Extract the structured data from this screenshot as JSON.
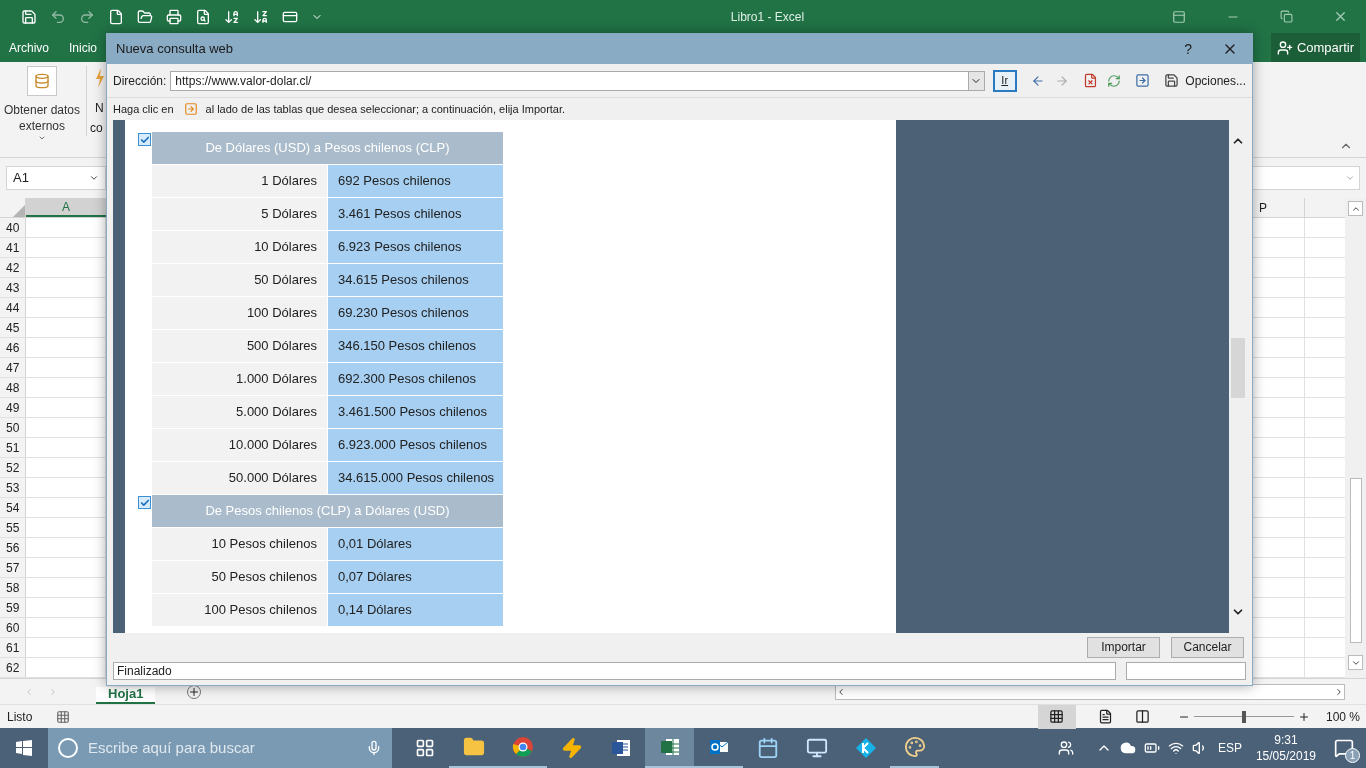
{
  "excel": {
    "title": "Libro1 - Excel",
    "ribbon_tabs": [
      "Archivo",
      "Inicio"
    ],
    "share": "Compartir",
    "ribbon": {
      "get_external_data": "Obtener datos externos",
      "cut_label_1": "N",
      "cut_label_2": "co"
    },
    "name_box": "A1",
    "columns": [
      "A",
      "P"
    ],
    "rows": [
      "40",
      "41",
      "42",
      "43",
      "44",
      "45",
      "46",
      "47",
      "48",
      "49",
      "50",
      "51",
      "52",
      "53",
      "54",
      "55",
      "56",
      "57",
      "58",
      "59",
      "60",
      "61",
      "62"
    ],
    "sheet_tabs": [
      {
        "label": "Hoja1",
        "selected": true
      }
    ],
    "status": "Listo",
    "zoom": "100 %",
    "zoom_slider": {
      "level": 0.5
    }
  },
  "dialog": {
    "title": "Nueva consulta web",
    "help": "?",
    "address_label": "Dirección:",
    "address": "https://www.valor-dolar.cl/",
    "go": "Ir",
    "options": "Opciones...",
    "hint_before": "Haga clic en",
    "hint_after": "al lado de las tablas que desea seleccionar; a continuación, elija Importar.",
    "tables": [
      {
        "checked": true,
        "title": "De Dólares (USD) a Pesos chilenos (CLP)",
        "rows": [
          [
            "1 Dólares",
            "692 Pesos chilenos"
          ],
          [
            "5 Dólares",
            "3.461 Pesos chilenos"
          ],
          [
            "10 Dólares",
            "6.923 Pesos chilenos"
          ],
          [
            "50 Dólares",
            "34.615 Pesos chilenos"
          ],
          [
            "100 Dólares",
            "69.230 Pesos chilenos"
          ],
          [
            "500 Dólares",
            "346.150 Pesos chilenos"
          ],
          [
            "1.000 Dólares",
            "692.300 Pesos chilenos"
          ],
          [
            "5.000 Dólares",
            "3.461.500 Pesos chilenos"
          ],
          [
            "10.000 Dólares",
            "6.923.000 Pesos chilenos"
          ],
          [
            "50.000 Dólares",
            "34.615.000 Pesos chilenos"
          ]
        ]
      },
      {
        "checked": true,
        "title": "De Pesos chilenos (CLP) a Dólares (USD)",
        "rows": [
          [
            "10 Pesos chilenos",
            "0,01 Dólares"
          ],
          [
            "50 Pesos chilenos",
            "0,07 Dólares"
          ],
          [
            "100 Pesos chilenos",
            "0,14 Dólares"
          ]
        ]
      }
    ],
    "buttons": [
      "Importar",
      "Cancelar"
    ],
    "status": "Finalizado"
  },
  "taskbar": {
    "search_placeholder": "Escribe aquí para buscar",
    "apps": [
      {
        "kind": "task_view",
        "running": false,
        "active": false
      },
      {
        "kind": "explorer",
        "running": true,
        "active": false
      },
      {
        "kind": "chrome",
        "running": true,
        "active": false
      },
      {
        "kind": "winamp",
        "running": false,
        "active": false
      },
      {
        "kind": "word",
        "running": false,
        "active": false
      },
      {
        "kind": "excel",
        "running": true,
        "active": true
      },
      {
        "kind": "outlook",
        "running": true,
        "active": false
      },
      {
        "kind": "control",
        "running": false,
        "active": false
      },
      {
        "kind": "remote",
        "running": false,
        "active": false
      },
      {
        "kind": "kodi",
        "running": false,
        "active": false
      },
      {
        "kind": "paint",
        "running": true,
        "active": false
      }
    ],
    "language": "ESP",
    "time": "9:31",
    "date": "15/05/2019",
    "notifications": "1"
  }
}
